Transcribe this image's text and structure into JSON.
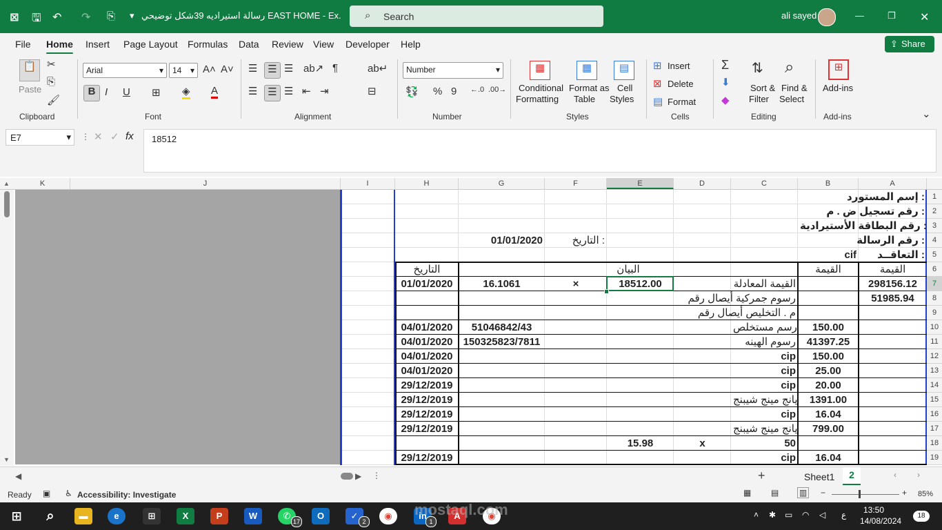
{
  "window": {
    "title": "رسالة استيراديه 39شكل توضيحي EAST HOME  -  Ex...",
    "user": "ali sayed",
    "search_placeholder": "Search"
  },
  "menu": {
    "tabs": [
      "File",
      "Home",
      "Insert",
      "Page Layout",
      "Formulas",
      "Data",
      "Review",
      "View",
      "Developer",
      "Help"
    ],
    "active": "Home",
    "share": "Share"
  },
  "ribbon": {
    "groups": {
      "clipboard": "Clipboard",
      "font": "Font",
      "alignment": "Alignment",
      "number": "Number",
      "styles": "Styles",
      "cells": "Cells",
      "editing": "Editing",
      "addins": "Add-ins"
    },
    "paste": "Paste",
    "font_name": "Arial",
    "font_size": "14",
    "number_format": "Number",
    "conditional": [
      "Conditional",
      "Formatting"
    ],
    "format_table": [
      "Format as",
      "Table"
    ],
    "cell_styles": [
      "Cell",
      "Styles"
    ],
    "insert": "Insert",
    "delete": "Delete",
    "format": "Format",
    "sort": [
      "Sort &",
      "Filter"
    ],
    "find": [
      "Find &",
      "Select"
    ],
    "addins_btn": "Add-ins"
  },
  "formula_bar": {
    "name_box": "E7",
    "formula": "18512"
  },
  "columns": [
    "K",
    "J",
    "I",
    "H",
    "G",
    "F",
    "E",
    "D",
    "C",
    "B",
    "A"
  ],
  "rows": [
    "1",
    "2",
    "3",
    "4",
    "5",
    "6",
    "7",
    "8",
    "9",
    "10",
    "11",
    "12",
    "13",
    "14",
    "15",
    "16",
    "17",
    "18",
    "19"
  ],
  "cells": {
    "A1": "إسم المستورد :",
    "A2": "رقم تسجيل ض . م :",
    "A3": "رقم البطاقة الأستيرادية :",
    "A4": "رقم الرسالة :",
    "A5": "التعاقــد :",
    "B5": "cif",
    "F4": "التاريخ :",
    "G4": "01/01/2020",
    "A6": "القيمة",
    "B6": "القيمة",
    "E6": "البيان",
    "H6": "التاريخ",
    "A7": "298156.12",
    "C7": "القيمة المعادلة",
    "E7": "18512.00",
    "F7": "×",
    "G7": "16.1061",
    "H7": "01/01/2020",
    "A8": "51985.94",
    "C8": "رسوم جمركية أيصال رقم",
    "C9": "م . التخليص أيصال رقم",
    "B10": "150.00",
    "C10": "رسم مستخلص",
    "G10": "51046842/43",
    "H10": "04/01/2020",
    "B11": "41397.25",
    "C11": "رسوم الهينه",
    "G11": "150325823/7811",
    "H11": "04/01/2020",
    "B12": "150.00",
    "C12": "cip",
    "H12": "04/01/2020",
    "B13": "25.00",
    "C13": "cip",
    "H13": "04/01/2020",
    "B14": "20.00",
    "C14": "cip",
    "H14": "29/12/2019",
    "B15": "1391.00",
    "C15": "يانج مينج شيبنج",
    "H15": "29/12/2019",
    "B16": "16.04",
    "C16": "cip",
    "H16": "29/12/2019",
    "B17": "799.00",
    "C17": "يانج مينج شيبنج",
    "H17": "29/12/2019",
    "C18": "50",
    "D18": "x",
    "E18": "15.98",
    "B19": "16.04",
    "C19": "cip",
    "H19": "29/12/2019"
  },
  "sheets": {
    "tab1": "Sheet1",
    "tab2": "2"
  },
  "status": {
    "ready": "Ready",
    "accessibility": "Accessibility: Investigate",
    "zoom": "85%"
  },
  "taskbar": {
    "time": "13:50",
    "date": "14/08/2024",
    "lang": "ع",
    "notif": "18",
    "whatsapp_badge": "17",
    "todo_badge": "2",
    "linkedin_badge": "1"
  },
  "watermark": "mostaql.com"
}
